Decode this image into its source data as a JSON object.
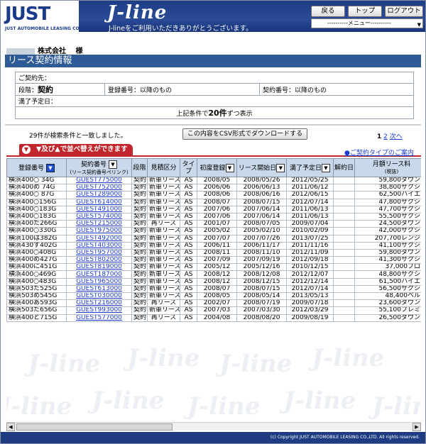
{
  "header": {
    "logo_mark": "JUST",
    "logo_sub": "JUST AUTOMOBILE LEASING CO.,LTD.",
    "brand": "J-line",
    "tagline": "J-lineをご利用いただきありがとうございます。",
    "back_label": "戻る",
    "top_label": "トップ",
    "logout_label": "ログアウト",
    "menu_value": "----------メニュー----------"
  },
  "company": {
    "suffix": "株式会社　 様"
  },
  "page_title": "リース契約情報",
  "info": {
    "contract_dest_label": "ご契約先：",
    "stage_label": "段階：",
    "stage_value": "契約",
    "regno_label": "登録番号：以降のもの",
    "contractno_label": "契約番号：以降のもの",
    "expiry_label": "満了予定日：",
    "display_prefix": "上記条件で",
    "display_count": "20件",
    "display_suffix": "ずつ表示"
  },
  "result_text": "29件が検索条件と一致しました。",
  "csv_button": "この内容をCSV形式でダウンロードする",
  "pager": {
    "current": "1",
    "page2": "2",
    "next": "次へ"
  },
  "sort_banner": "▼及び▲で並べ替えができます",
  "type_link": "●ご契約タイプのご案内",
  "columns": [
    "登録番号",
    "契約番号",
    "(リース契約番号ペリンク)",
    "段階",
    "見積区分",
    "タイプ",
    "初度登録",
    "リース開始日",
    "満了予定日",
    "解約日",
    "月額リース料",
    "(税抜)"
  ],
  "rows": [
    [
      "横浜400○ 34G",
      "GUEST775000",
      "契約",
      "新車リース",
      "AS",
      "2008/05",
      "2008/05/26",
      "2012/05/25",
      "",
      "59,800",
      "ダウンロ"
    ],
    [
      "横浜400め 74G",
      "GUEST752000",
      "契約",
      "新車リース",
      "AS",
      "2006/06",
      "2006/06/13",
      "2011/06/12",
      "",
      "38,800",
      "サクシー"
    ],
    [
      "横浜400○ 87G",
      "GUEST289000",
      "契約",
      "新車リース",
      "AS",
      "2008/06",
      "2008/06/16",
      "2012/06/15",
      "",
      "62,500",
      "ハイエー"
    ],
    [
      "横浜400○156G",
      "GUEST614000",
      "契約",
      "新車リース",
      "AS",
      "2008/07",
      "2008/07/15",
      "2012/07/14",
      "",
      "47,800",
      "サクシー"
    ],
    [
      "横浜400○183G",
      "GUEST491000",
      "契約",
      "新車リース",
      "AS",
      "2007/06",
      "2007/06/14",
      "2011/06/13",
      "",
      "47,700",
      "サクシー"
    ],
    [
      "横浜400○183G",
      "GUEST574000",
      "契約",
      "新車リース",
      "AS",
      "2007/06",
      "2007/06/14",
      "2011/06/13",
      "",
      "55,500",
      "サクシー"
    ],
    [
      "横浜400た266G",
      "GUEST215000",
      "契約",
      "再リース",
      "AS",
      "2001/07",
      "2008/07/05",
      "2009/07/04",
      "",
      "24,500",
      "ダウンロ"
    ],
    [
      "横浜400○330G",
      "GUEST975000",
      "契約",
      "新車リース",
      "AS",
      "2005/02",
      "2005/02/10",
      "2010/02/09",
      "",
      "42,000",
      "サクシー"
    ],
    [
      "横浜100は382G",
      "GUEST492000",
      "契約",
      "新車リース",
      "AS",
      "2007/07",
      "2007/07/26",
      "2013/07/25",
      "",
      "207,700",
      "レンジー"
    ],
    [
      "横浜430す402G",
      "GUEST403000",
      "契約",
      "新車リース",
      "AS",
      "2006/11",
      "2006/11/17",
      "2011/11/16",
      "",
      "41,100",
      "サクシー"
    ],
    [
      "横浜400○408G",
      "GUEST957000",
      "契約",
      "新車リース",
      "AS",
      "2008/11",
      "2008/11/10",
      "2012/11/09",
      "",
      "59,800",
      "ダウンロ"
    ],
    [
      "横浜400め427G",
      "GUEST802000",
      "契約",
      "新車リース",
      "AS",
      "2007/09",
      "2007/09/19",
      "2012/09/18",
      "",
      "41,300",
      "サクシー"
    ],
    [
      "横浜400に451G",
      "GUEST819000",
      "契約",
      "新車リース",
      "AS",
      "2005/12",
      "2005/12/16",
      "2010/12/15",
      "",
      "37,000",
      "プロボ"
    ],
    [
      "横浜400○469G",
      "GUEST187000",
      "契約",
      "新車リース",
      "AS",
      "2008/12",
      "2008/12/08",
      "2012/12/07",
      "",
      "48,800",
      "サクシー"
    ],
    [
      "横浜400○483G",
      "GUEST965000",
      "契約",
      "新車リース",
      "AS",
      "2008/12",
      "2008/12/15",
      "2012/12/14",
      "",
      "61,500",
      "ハイエー"
    ],
    [
      "横浜503た525G",
      "GUEST613000",
      "契約",
      "新車リース",
      "AS",
      "2008/07",
      "2008/07/15",
      "2012/07/14",
      "",
      "56,500",
      "サクシー"
    ],
    [
      "横浜503め545G",
      "GUEST030000",
      "契約",
      "新車リース",
      "AS",
      "2008/05",
      "2008/05/14",
      "2013/05/13",
      "",
      "48,400",
      "ベルタ"
    ],
    [
      "横浜400あ593G",
      "GUEST216000",
      "契約",
      "再リース",
      "AS",
      "2002/07",
      "2008/07/19",
      "2009/07/18",
      "",
      "23,600",
      "ダウンロ"
    ],
    [
      "横浜503た656G",
      "GUEST993000",
      "契約",
      "新車リース",
      "AS",
      "2007/03",
      "2007/03/30",
      "2012/03/29",
      "",
      "55,100",
      "プレミオ"
    ],
    [
      "横浜400と715G",
      "GUEST577000",
      "契約",
      "再リース",
      "AS",
      "2004/08",
      "2008/08/20",
      "2009/08/19",
      "",
      "26,500",
      "ダウンロ"
    ]
  ],
  "watermark": "J-line",
  "footer": "(c) Copyright JUST AUTOMOBILE LEASING CO.,LTD. All rights reserved."
}
